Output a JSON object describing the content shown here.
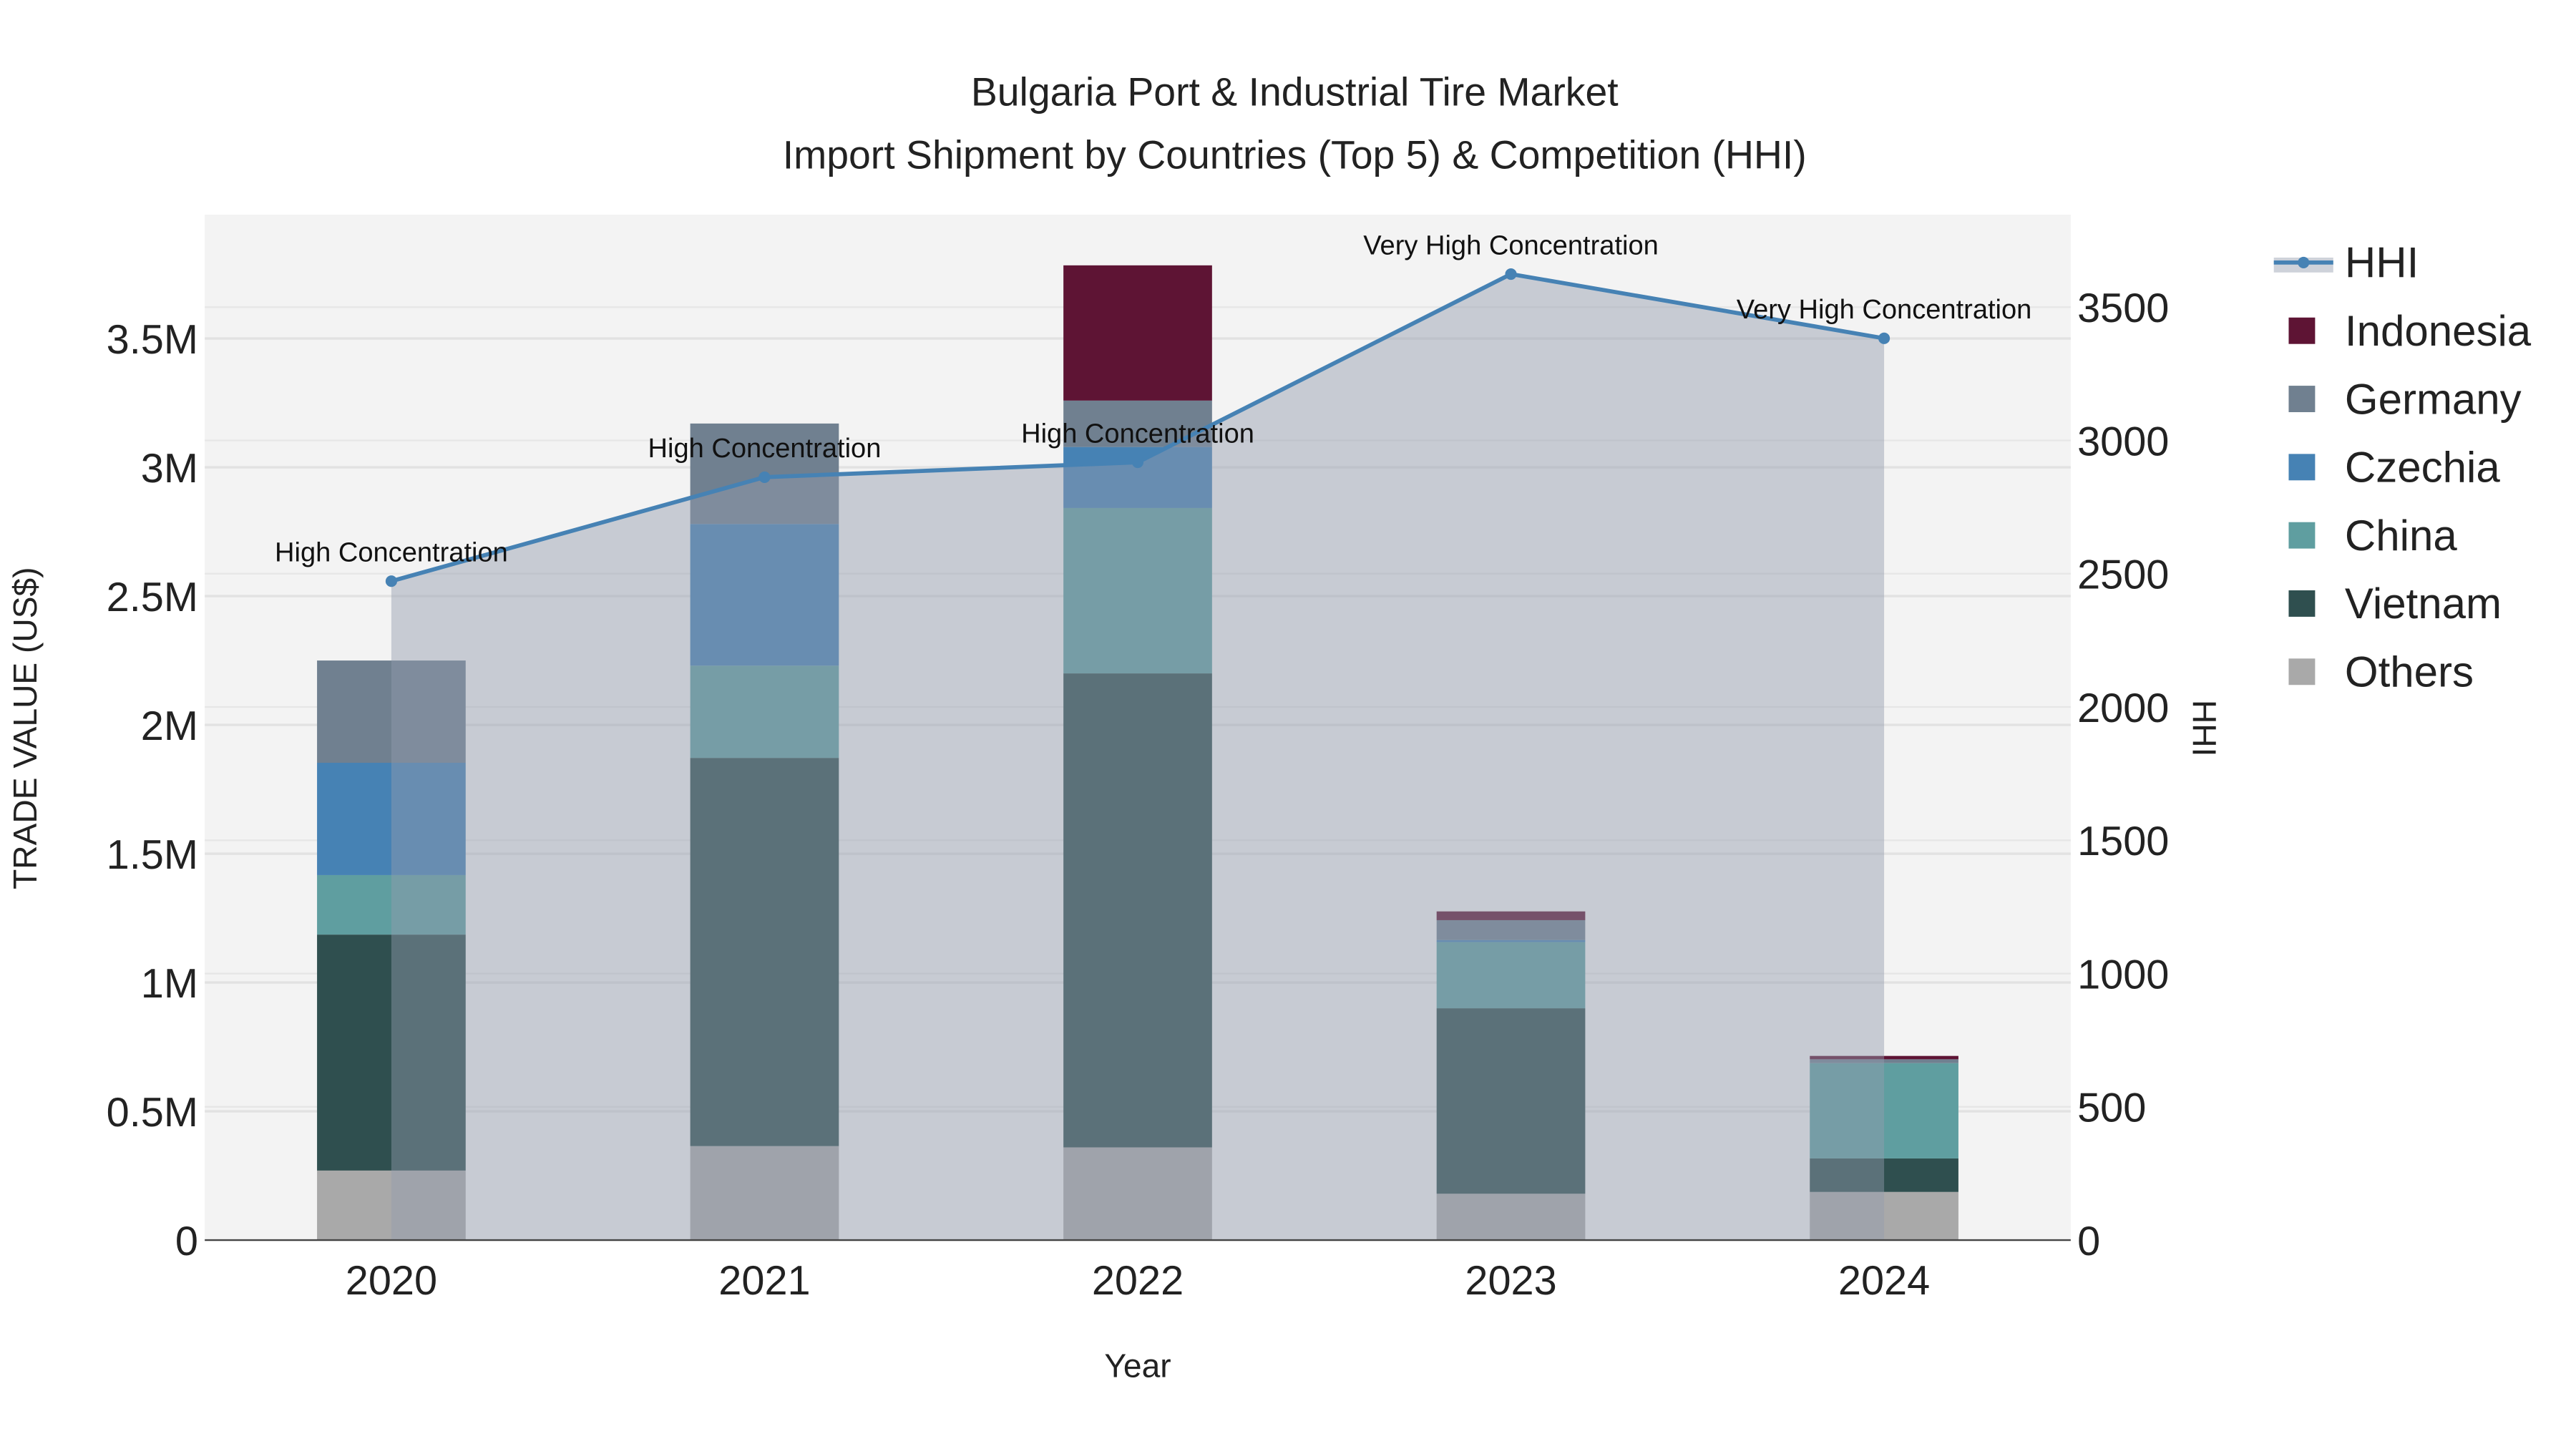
{
  "chart_data": {
    "type": "bar",
    "title": "Bulgaria Port & Industrial Tire Market",
    "subtitle": "Import Shipment by Countries (Top 5) & Competition (HHI)",
    "xlabel": "Year",
    "ylabel": "TRADE VALUE (US$)",
    "y2label": "HHI",
    "categories": [
      "2020",
      "2021",
      "2022",
      "2023",
      "2024"
    ],
    "stacked": true,
    "ylim": [
      0,
      3980000
    ],
    "y2lim": [
      0,
      3850
    ],
    "yticks": [
      {
        "value": 0,
        "label": "0"
      },
      {
        "value": 500000,
        "label": "0.5M"
      },
      {
        "value": 1000000,
        "label": "1M"
      },
      {
        "value": 1500000,
        "label": "1.5M"
      },
      {
        "value": 2000000,
        "label": "2M"
      },
      {
        "value": 2500000,
        "label": "2.5M"
      },
      {
        "value": 3000000,
        "label": "3M"
      },
      {
        "value": 3500000,
        "label": "3.5M"
      }
    ],
    "y2ticks": [
      {
        "value": 0,
        "label": "0"
      },
      {
        "value": 500,
        "label": "500"
      },
      {
        "value": 1000,
        "label": "1000"
      },
      {
        "value": 1500,
        "label": "1500"
      },
      {
        "value": 2000,
        "label": "2000"
      },
      {
        "value": 2500,
        "label": "2500"
      },
      {
        "value": 3000,
        "label": "3000"
      },
      {
        "value": 3500,
        "label": "3500"
      }
    ],
    "series": [
      {
        "name": "Others",
        "color": "#a9a9a9",
        "values": [
          270000,
          365000,
          360000,
          180000,
          187000
        ]
      },
      {
        "name": "Vietnam",
        "color": "#2f4f4f",
        "values": [
          916000,
          1507000,
          1840000,
          720000,
          130000
        ]
      },
      {
        "name": "China",
        "color": "#5f9ea0",
        "values": [
          231000,
          358000,
          642000,
          257000,
          370000
        ]
      },
      {
        "name": "Czechia",
        "color": "#4682b4",
        "values": [
          436000,
          550000,
          237000,
          8000,
          0
        ]
      },
      {
        "name": "Germany",
        "color": "#708090",
        "values": [
          397000,
          390000,
          180000,
          77000,
          15000
        ]
      },
      {
        "name": "Indonesia",
        "color": "#5e1434",
        "values": [
          0,
          0,
          525000,
          34000,
          13000
        ]
      }
    ],
    "hhi": {
      "name": "HHI",
      "color": "#4682b4",
      "values": [
        2472,
        2862,
        2918,
        3624,
        3383
      ],
      "annotations": [
        "High Concentration",
        "High Concentration",
        "High Concentration",
        "Very High Concentration",
        "Very High Concentration"
      ]
    },
    "legend": {
      "placement": "right",
      "items": [
        "HHI",
        "Indonesia",
        "Germany",
        "Czechia",
        "China",
        "Vietnam",
        "Others"
      ]
    },
    "grid": true
  }
}
